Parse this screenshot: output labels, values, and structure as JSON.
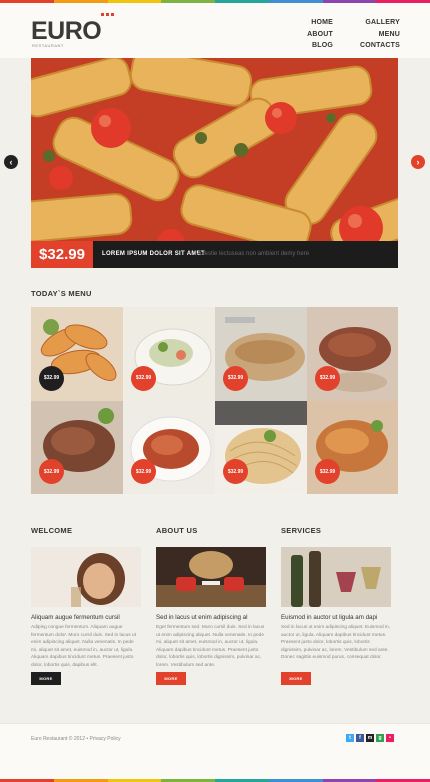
{
  "brand": {
    "logo_text": "EURO",
    "tagline": "RESTAURANT",
    "accent_color": "#e2412c",
    "strip_colors": [
      "#e2412c",
      "#f39c12",
      "#f1c40f",
      "#7cb342",
      "#26a69a",
      "#3f8fd2",
      "#8e44ad",
      "#e91e63"
    ]
  },
  "nav": {
    "col_a": [
      "HOME",
      "ABOUT",
      "BLOG"
    ],
    "col_b": [
      "GALLERY",
      "MENU",
      "CONTACTS"
    ]
  },
  "slider": {
    "price": "$32.99",
    "caption_title": "LOREM IPSUM DOLOR SIT AMET",
    "caption_subtitle": "Molestie lectuseas non ambient demy here",
    "prev_icon": "chevron-left-icon",
    "next_icon": "chevron-right-icon",
    "prev_glyph": "‹",
    "next_glyph": "›"
  },
  "menu": {
    "title": "TODAY`S MENU",
    "items": [
      {
        "price": "$32.99",
        "dish": "shrimp"
      },
      {
        "price": "$32.99",
        "dish": "salad"
      },
      {
        "price": "$32.99",
        "dish": "fish"
      },
      {
        "price": "$32.99",
        "dish": "steak"
      },
      {
        "price": "$32.99",
        "dish": "beef"
      },
      {
        "price": "$32.99",
        "dish": "stew"
      },
      {
        "price": "$32.99",
        "dish": "pasta"
      },
      {
        "price": "$32.99",
        "dish": "chicken"
      }
    ]
  },
  "columns": [
    {
      "title": "WELCOME",
      "headline": "Aliquam augue fermentum  cursil",
      "body": "Adipisg congue fermentum. Aliquam augue fermentum dolor. Muro cursil duis. Sed in lacus ut enim adipiscing aliquet. Nulla venenatis. In pede mi, aliquet sit amet, euismod in, auctor ut, ligula. Aliquam dapibus tincidunt metus. Praesent justo dolor, lobortis quis, dapibus elit.",
      "button": "MORE",
      "button_color": "#1f1f1f"
    },
    {
      "title": "ABOUT US",
      "headline": "Sed in lacus ut enim adipiscing al",
      "body": "Eget fermentum sed. Muro cursil duis. Sed in lacus ut enim adipiscing aliquet. Nulla venenatis. In pede mi, aliquet sit amet, euismod in, auctor ut, ligula. Aliquam dapibus tincidunt metus. Praesent justo dolor, lobortis quis, lobortis dignissim, pulvinar ac, lorem. Vestibulum sed ante.",
      "button": "MORE",
      "button_color": "#e2412c"
    },
    {
      "title": "SERVICES",
      "headline": "Euismod in auctor ut ligula am dapi",
      "body": "Sed in lacus ut enim adipiscing aliquet. Euismod in, auctor ut, ligula. Aliquam dapibus tincidunt metus. Praesent justo dolor, lobortis quis, lobortis dignissim, pulvinar ac, lorem. Vestibulum sed ante. Donec sagittis euismod purus, consequat dolor.",
      "button": "MORE",
      "button_color": "#e2412c"
    }
  ],
  "footer": {
    "copyright": "Euro Restaurant © 2012 • Privacy Policy",
    "social": [
      {
        "icon": "twitter-icon",
        "glyph": "t",
        "color": "#3fa9f5"
      },
      {
        "icon": "facebook-icon",
        "glyph": "f",
        "color": "#3b5998"
      },
      {
        "icon": "myspace-icon",
        "glyph": "m",
        "color": "#222222"
      },
      {
        "icon": "google-icon",
        "glyph": "g",
        "color": "#37a152"
      },
      {
        "icon": "flickr-icon",
        "glyph": "•",
        "color": "#e91e63"
      }
    ]
  }
}
